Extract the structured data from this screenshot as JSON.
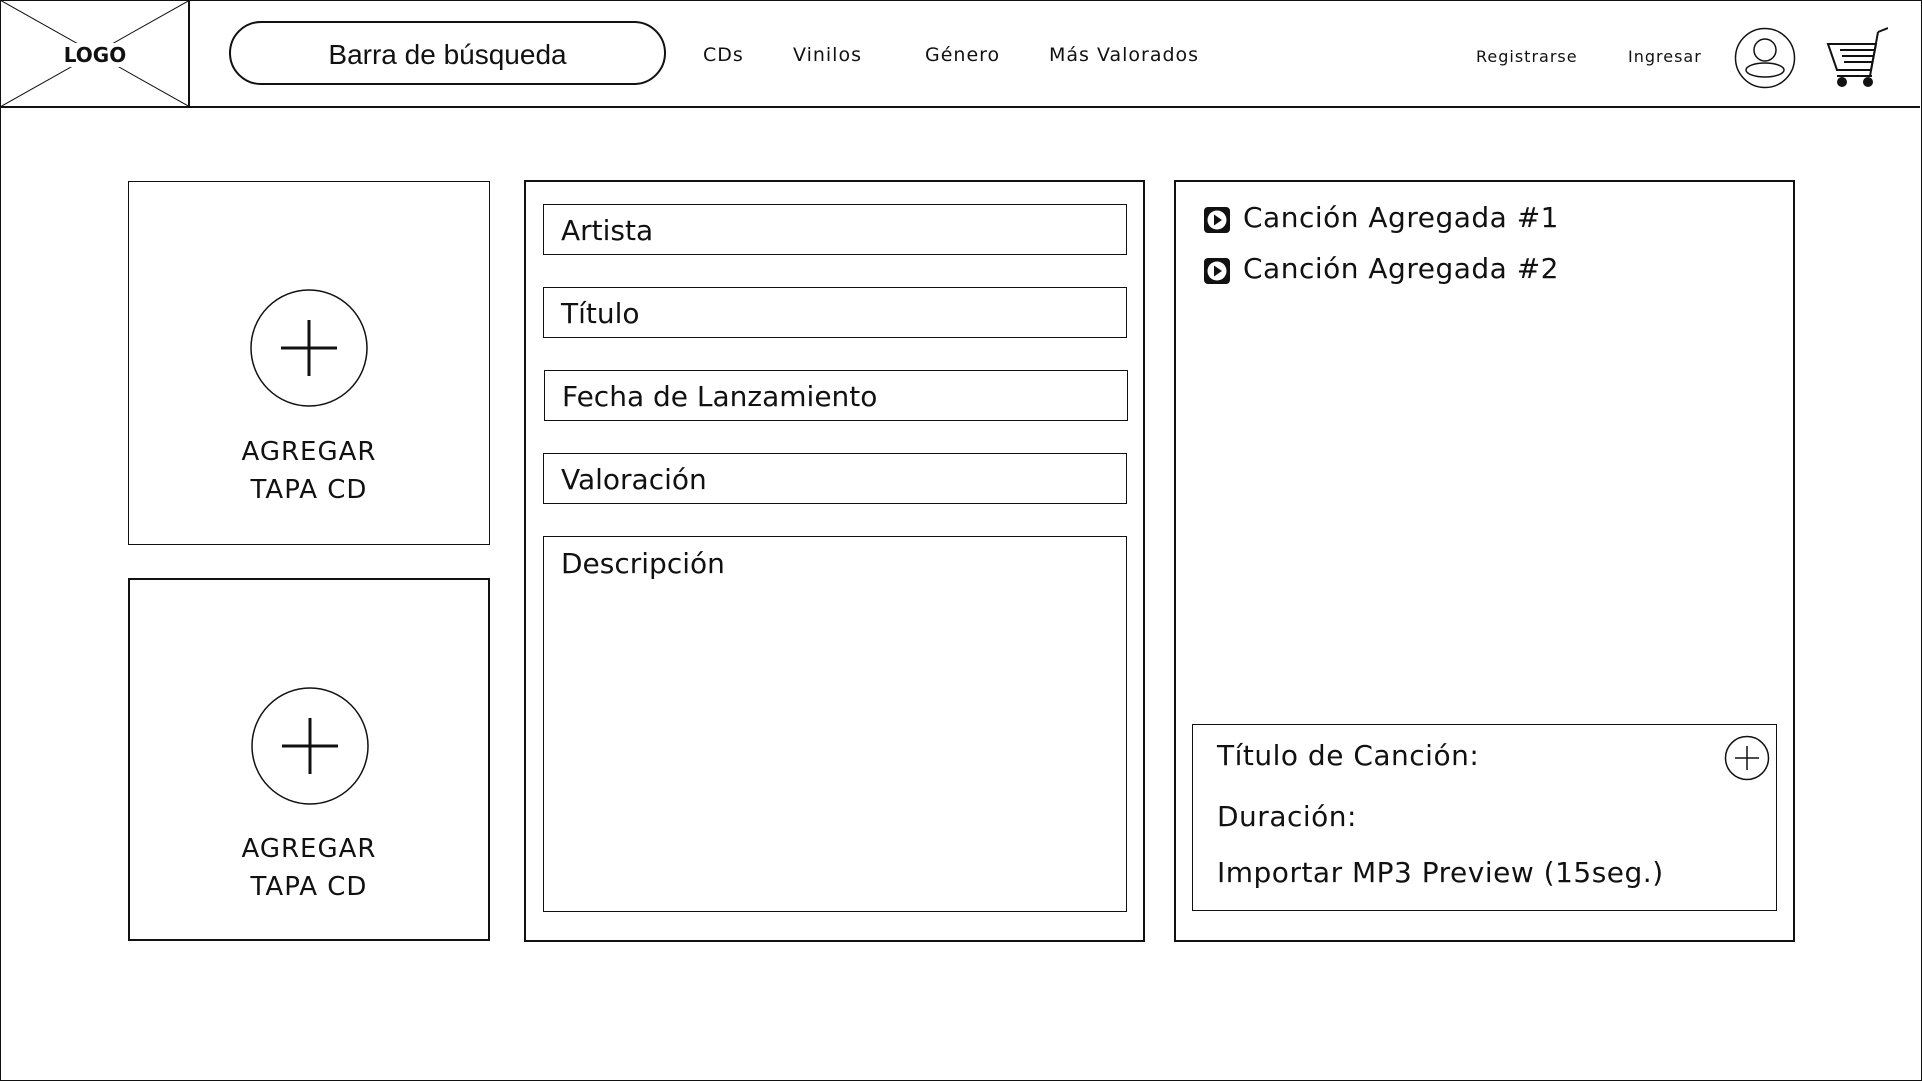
{
  "header": {
    "logo": "LOGO",
    "search": "Barra de búsqueda",
    "nav": [
      "CDs",
      "Vinilos",
      "Género",
      "Más Valorados"
    ],
    "register": "Registrarse",
    "login": "Ingresar"
  },
  "covers": [
    {
      "line1": "AGREGAR",
      "line2": "TAPA CD"
    },
    {
      "line1": "AGREGAR",
      "line2": "TAPA CD"
    }
  ],
  "form": {
    "artist": "Artista",
    "title": "Título",
    "release_date": "Fecha de Lanzamiento",
    "rating": "Valoración",
    "description": "Descripción"
  },
  "songs": {
    "items": [
      "Canción Agregada #1",
      "Canción Agregada #2"
    ],
    "new_song_title": "Título de Canción:",
    "duration": "Duración:",
    "import_preview": "Importar MP3 Preview (15seg.)"
  }
}
